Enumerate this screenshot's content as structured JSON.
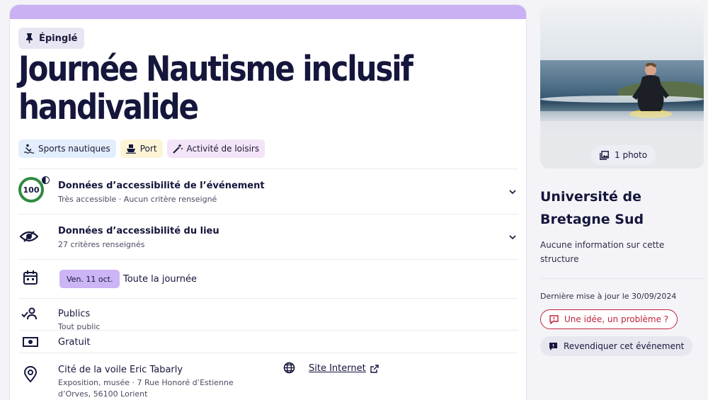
{
  "event": {
    "pinned_label": "Épinglé",
    "title_line1": "Journée Nautisme inclusif",
    "title_line2": "handivalide",
    "tags": [
      {
        "label": "Sports nautiques",
        "icon": "swimmer-icon"
      },
      {
        "label": "Port",
        "icon": "ship-icon"
      },
      {
        "label": "Activité de loisirs",
        "icon": "magic-wand-icon"
      }
    ],
    "accessibility_event": {
      "score": "100",
      "title": "Données d’accessibilité de l’événement",
      "subtitle": "Très accessible · Aucun critère renseigné"
    },
    "accessibility_place": {
      "title": "Données d’accessibilité du lieu",
      "subtitle": "27 critères renseignés"
    },
    "date": {
      "day": "Ven. 11 oct.",
      "time": "Toute la journée"
    },
    "audience": {
      "title": "Publics",
      "value": "Tout public"
    },
    "price": "Gratuit",
    "location": {
      "name": "Cité de la voile Eric Tabarly",
      "address_line1": "Exposition, musée · 7 Rue Honoré d’Estienne",
      "address_line2": "d’Orves, 56100 Lorient"
    },
    "website_label": "Site Internet"
  },
  "sidebar": {
    "photo_button": "1 photo",
    "org_line1": "Université de",
    "org_line2": "Bretagne Sud",
    "org_info_line1": "Aucune information sur cette",
    "org_info_line2": "structure",
    "updated": "Dernière mise à jour le 30/09/2024",
    "report_button": "Une idée, un problème ?",
    "claim_button": "Revendiquer cet événement"
  },
  "colors": {
    "accent": "#c9b1f3",
    "score_ring": "#2e8b3f",
    "danger": "#c0233a",
    "text": "#15163c"
  }
}
